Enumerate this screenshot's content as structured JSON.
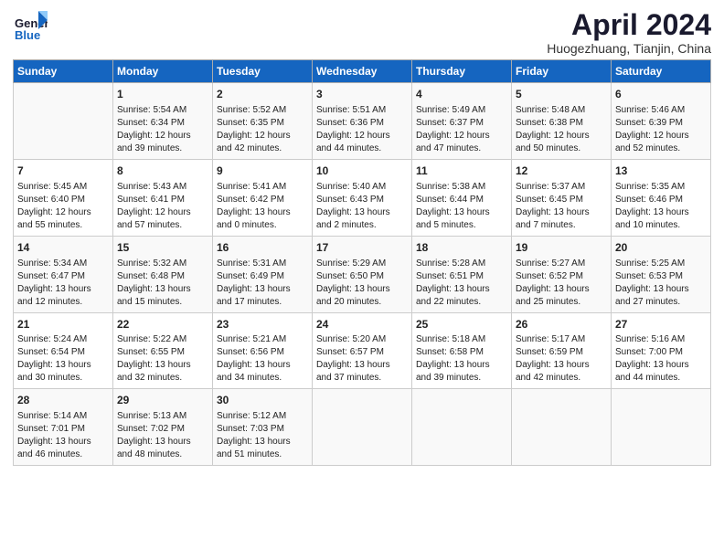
{
  "header": {
    "logo_line1": "General",
    "logo_line2": "Blue",
    "month": "April 2024",
    "location": "Huogezhuang, Tianjin, China"
  },
  "days_of_week": [
    "Sunday",
    "Monday",
    "Tuesday",
    "Wednesday",
    "Thursday",
    "Friday",
    "Saturday"
  ],
  "weeks": [
    [
      {
        "day": "",
        "content": ""
      },
      {
        "day": "1",
        "content": "Sunrise: 5:54 AM\nSunset: 6:34 PM\nDaylight: 12 hours\nand 39 minutes."
      },
      {
        "day": "2",
        "content": "Sunrise: 5:52 AM\nSunset: 6:35 PM\nDaylight: 12 hours\nand 42 minutes."
      },
      {
        "day": "3",
        "content": "Sunrise: 5:51 AM\nSunset: 6:36 PM\nDaylight: 12 hours\nand 44 minutes."
      },
      {
        "day": "4",
        "content": "Sunrise: 5:49 AM\nSunset: 6:37 PM\nDaylight: 12 hours\nand 47 minutes."
      },
      {
        "day": "5",
        "content": "Sunrise: 5:48 AM\nSunset: 6:38 PM\nDaylight: 12 hours\nand 50 minutes."
      },
      {
        "day": "6",
        "content": "Sunrise: 5:46 AM\nSunset: 6:39 PM\nDaylight: 12 hours\nand 52 minutes."
      }
    ],
    [
      {
        "day": "7",
        "content": "Sunrise: 5:45 AM\nSunset: 6:40 PM\nDaylight: 12 hours\nand 55 minutes."
      },
      {
        "day": "8",
        "content": "Sunrise: 5:43 AM\nSunset: 6:41 PM\nDaylight: 12 hours\nand 57 minutes."
      },
      {
        "day": "9",
        "content": "Sunrise: 5:41 AM\nSunset: 6:42 PM\nDaylight: 13 hours\nand 0 minutes."
      },
      {
        "day": "10",
        "content": "Sunrise: 5:40 AM\nSunset: 6:43 PM\nDaylight: 13 hours\nand 2 minutes."
      },
      {
        "day": "11",
        "content": "Sunrise: 5:38 AM\nSunset: 6:44 PM\nDaylight: 13 hours\nand 5 minutes."
      },
      {
        "day": "12",
        "content": "Sunrise: 5:37 AM\nSunset: 6:45 PM\nDaylight: 13 hours\nand 7 minutes."
      },
      {
        "day": "13",
        "content": "Sunrise: 5:35 AM\nSunset: 6:46 PM\nDaylight: 13 hours\nand 10 minutes."
      }
    ],
    [
      {
        "day": "14",
        "content": "Sunrise: 5:34 AM\nSunset: 6:47 PM\nDaylight: 13 hours\nand 12 minutes."
      },
      {
        "day": "15",
        "content": "Sunrise: 5:32 AM\nSunset: 6:48 PM\nDaylight: 13 hours\nand 15 minutes."
      },
      {
        "day": "16",
        "content": "Sunrise: 5:31 AM\nSunset: 6:49 PM\nDaylight: 13 hours\nand 17 minutes."
      },
      {
        "day": "17",
        "content": "Sunrise: 5:29 AM\nSunset: 6:50 PM\nDaylight: 13 hours\nand 20 minutes."
      },
      {
        "day": "18",
        "content": "Sunrise: 5:28 AM\nSunset: 6:51 PM\nDaylight: 13 hours\nand 22 minutes."
      },
      {
        "day": "19",
        "content": "Sunrise: 5:27 AM\nSunset: 6:52 PM\nDaylight: 13 hours\nand 25 minutes."
      },
      {
        "day": "20",
        "content": "Sunrise: 5:25 AM\nSunset: 6:53 PM\nDaylight: 13 hours\nand 27 minutes."
      }
    ],
    [
      {
        "day": "21",
        "content": "Sunrise: 5:24 AM\nSunset: 6:54 PM\nDaylight: 13 hours\nand 30 minutes."
      },
      {
        "day": "22",
        "content": "Sunrise: 5:22 AM\nSunset: 6:55 PM\nDaylight: 13 hours\nand 32 minutes."
      },
      {
        "day": "23",
        "content": "Sunrise: 5:21 AM\nSunset: 6:56 PM\nDaylight: 13 hours\nand 34 minutes."
      },
      {
        "day": "24",
        "content": "Sunrise: 5:20 AM\nSunset: 6:57 PM\nDaylight: 13 hours\nand 37 minutes."
      },
      {
        "day": "25",
        "content": "Sunrise: 5:18 AM\nSunset: 6:58 PM\nDaylight: 13 hours\nand 39 minutes."
      },
      {
        "day": "26",
        "content": "Sunrise: 5:17 AM\nSunset: 6:59 PM\nDaylight: 13 hours\nand 42 minutes."
      },
      {
        "day": "27",
        "content": "Sunrise: 5:16 AM\nSunset: 7:00 PM\nDaylight: 13 hours\nand 44 minutes."
      }
    ],
    [
      {
        "day": "28",
        "content": "Sunrise: 5:14 AM\nSunset: 7:01 PM\nDaylight: 13 hours\nand 46 minutes."
      },
      {
        "day": "29",
        "content": "Sunrise: 5:13 AM\nSunset: 7:02 PM\nDaylight: 13 hours\nand 48 minutes."
      },
      {
        "day": "30",
        "content": "Sunrise: 5:12 AM\nSunset: 7:03 PM\nDaylight: 13 hours\nand 51 minutes."
      },
      {
        "day": "",
        "content": ""
      },
      {
        "day": "",
        "content": ""
      },
      {
        "day": "",
        "content": ""
      },
      {
        "day": "",
        "content": ""
      }
    ]
  ]
}
